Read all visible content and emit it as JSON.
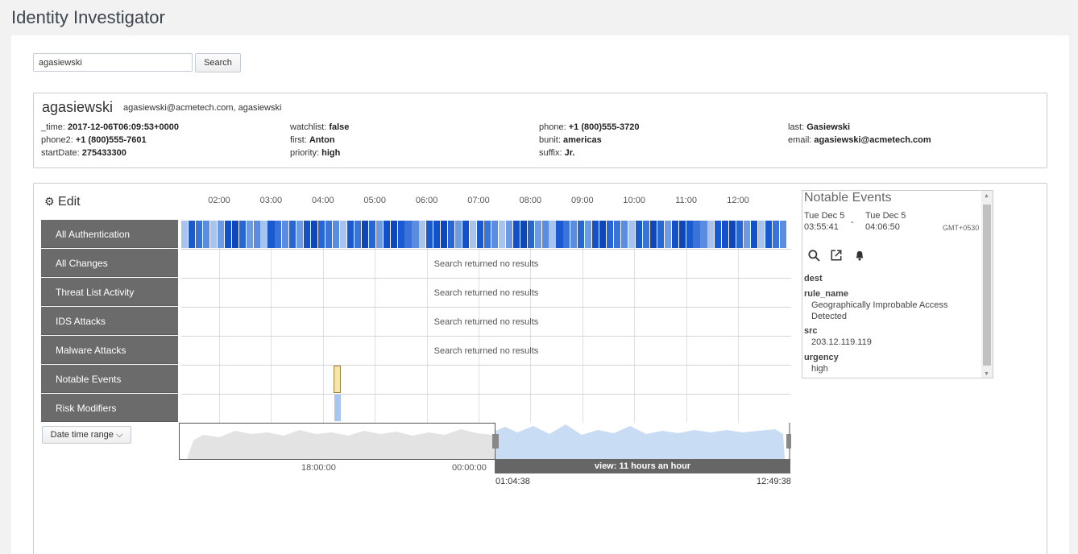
{
  "app": {
    "title": "Identity Investigator"
  },
  "search": {
    "value": "agasiewski",
    "button_label": "Search"
  },
  "identity": {
    "name": "agasiewski",
    "aliases": "agasiewski@acmetech.com, agasiewski",
    "fields": [
      {
        "key": "_time:",
        "value": "2017-12-06T06:09:53+0000"
      },
      {
        "key": "phone2:",
        "value": "+1 (800)555-7601"
      },
      {
        "key": "startDate:",
        "value": "275433300"
      },
      {
        "key": "watchlist:",
        "value": "false"
      },
      {
        "key": "first:",
        "value": "Anton"
      },
      {
        "key": "priority:",
        "value": "high"
      },
      {
        "key": "phone:",
        "value": "+1 (800)555-3720"
      },
      {
        "key": "bunit:",
        "value": "americas"
      },
      {
        "key": "suffix:",
        "value": "Jr."
      },
      {
        "key": "last:",
        "value": "Gasiewski"
      },
      {
        "key": "email:",
        "value": "agasiewski@acmetech.com"
      }
    ]
  },
  "timeline": {
    "edit_label": "Edit",
    "hours": [
      "02:00",
      "03:00",
      "04:00",
      "05:00",
      "06:00",
      "07:00",
      "08:00",
      "09:00",
      "10:00",
      "11:00",
      "12:00"
    ],
    "swimlanes": [
      {
        "label": "All Authentication",
        "status": ""
      },
      {
        "label": "All Changes",
        "status": "Search returned no results"
      },
      {
        "label": "Threat List Activity",
        "status": "Search returned no results"
      },
      {
        "label": "IDS Attacks",
        "status": "Search returned no results"
      },
      {
        "label": "Malware Attacks",
        "status": "Search returned no results"
      },
      {
        "label": "Notable Events",
        "status": ""
      },
      {
        "label": "Risk Modifiers",
        "status": ""
      }
    ],
    "date_range_label": "Date time range ⌵",
    "overview": {
      "tick_1": "18:00:00",
      "tick_2": "00:00:00",
      "view_label": "view: 11 hours an hour",
      "start_time": "01:04:38",
      "end_time": "12:49:38"
    }
  },
  "notable_panel": {
    "title": "Notable Events",
    "start_day": "Tue Dec 5",
    "start_time": "03:55:41",
    "separator": "-",
    "end_day": "Tue Dec 5",
    "end_time": "04:06:50",
    "timezone": "GMT+0530",
    "fields": {
      "dest_key": "dest",
      "rule_name_key": "rule_name",
      "rule_name_value_1": "Geographically Improbable Access",
      "rule_name_value_2": "Detected",
      "src_key": "src",
      "src_value": "203.12.119.119",
      "urgency_key": "urgency",
      "urgency_value": "high"
    }
  },
  "colors": {
    "swimlane_label_bg": "#6b6b6b",
    "auth_dark": "#1450c8",
    "auth_light": "#a8c4ee",
    "notable_event": "#f6e4aa",
    "risk_modifier": "#a9c6ef"
  }
}
